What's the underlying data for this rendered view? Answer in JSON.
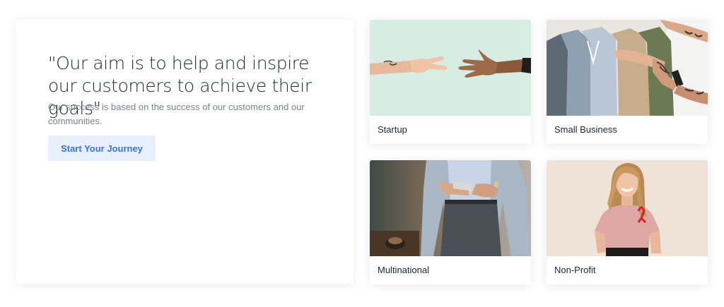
{
  "hero": {
    "quote": "\"Our aim is to help and inspire our customers to achieve their goals\"",
    "description": "Our success is based on the success of our customers and our communities.",
    "cta_label": "Start Your Journey"
  },
  "categories": [
    {
      "label": "Startup",
      "image": "hands-peace-sign-photo",
      "background": "#d7ede3"
    },
    {
      "label": "Small Business",
      "image": "clothing-rack-photo",
      "background": "#e9e6e1"
    },
    {
      "label": "Multinational",
      "image": "businessman-phone-photo",
      "background": "#5a4a3c"
    },
    {
      "label": "Non-Profit",
      "image": "woman-red-ribbon-photo",
      "background": "#efe3d8"
    }
  ],
  "colors": {
    "accent": "#3d6fe0",
    "accent_bg": "#e8f0fd",
    "text": "#222831",
    "muted": "#7b818c"
  }
}
